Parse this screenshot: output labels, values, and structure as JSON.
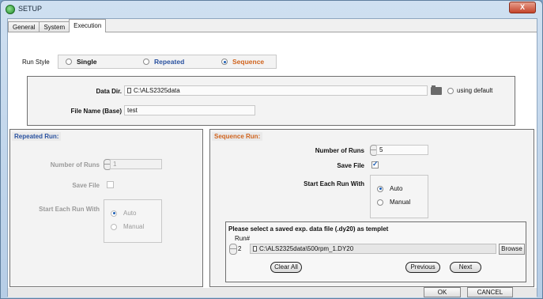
{
  "window": {
    "title": "SETUP",
    "close_label": "X"
  },
  "tabs": [
    {
      "label": "General",
      "active": false
    },
    {
      "label": "System",
      "active": false
    },
    {
      "label": "Execution",
      "active": true
    }
  ],
  "run_style": {
    "label": "Run Style",
    "options": [
      {
        "label": "Single",
        "selected": false,
        "color": "#111111"
      },
      {
        "label": "Repeated",
        "selected": false,
        "color": "#2a52a0"
      },
      {
        "label": "Sequence",
        "selected": true,
        "color": "#d0641e"
      }
    ]
  },
  "data_dir": {
    "label": "Data Dir.",
    "value": "C:\\ALS2325data",
    "folder_icon": "folder-icon",
    "default_radio_label": "using default"
  },
  "file_name": {
    "label": "File Name (Base)",
    "value": "test"
  },
  "repeated_run": {
    "title": "Repeated Run:",
    "title_color": "#2a52a0",
    "number_of_runs_label": "Number of Runs",
    "number_of_runs_value": "1",
    "save_file_label": "Save File",
    "save_file_checked": false,
    "start_each_label": "Start Each Run With",
    "options": [
      {
        "label": "Auto",
        "selected": true
      },
      {
        "label": "Manual",
        "selected": false
      }
    ]
  },
  "sequence_run": {
    "title": "Sequence Run:",
    "title_color": "#d0641e",
    "number_of_runs_label": "Number of Runs",
    "number_of_runs_value": "5",
    "save_file_label": "Save File",
    "save_file_checked": true,
    "start_each_label": "Start Each Run With",
    "options": [
      {
        "label": "Auto",
        "selected": true
      },
      {
        "label": "Manual",
        "selected": false
      }
    ]
  },
  "template": {
    "heading": "Please select a saved exp. data file (.dy20) as templet",
    "run_label": "Run#",
    "run_value": "2",
    "file_path": "C:\\ALS2325data\\500rpm_1.DY20",
    "browse_label": "Browse",
    "clear_all_label": "Clear All",
    "previous_label": "Previous",
    "next_label": "Next"
  },
  "footer": {
    "ok_label": "OK",
    "cancel_label": "CANCEL"
  }
}
